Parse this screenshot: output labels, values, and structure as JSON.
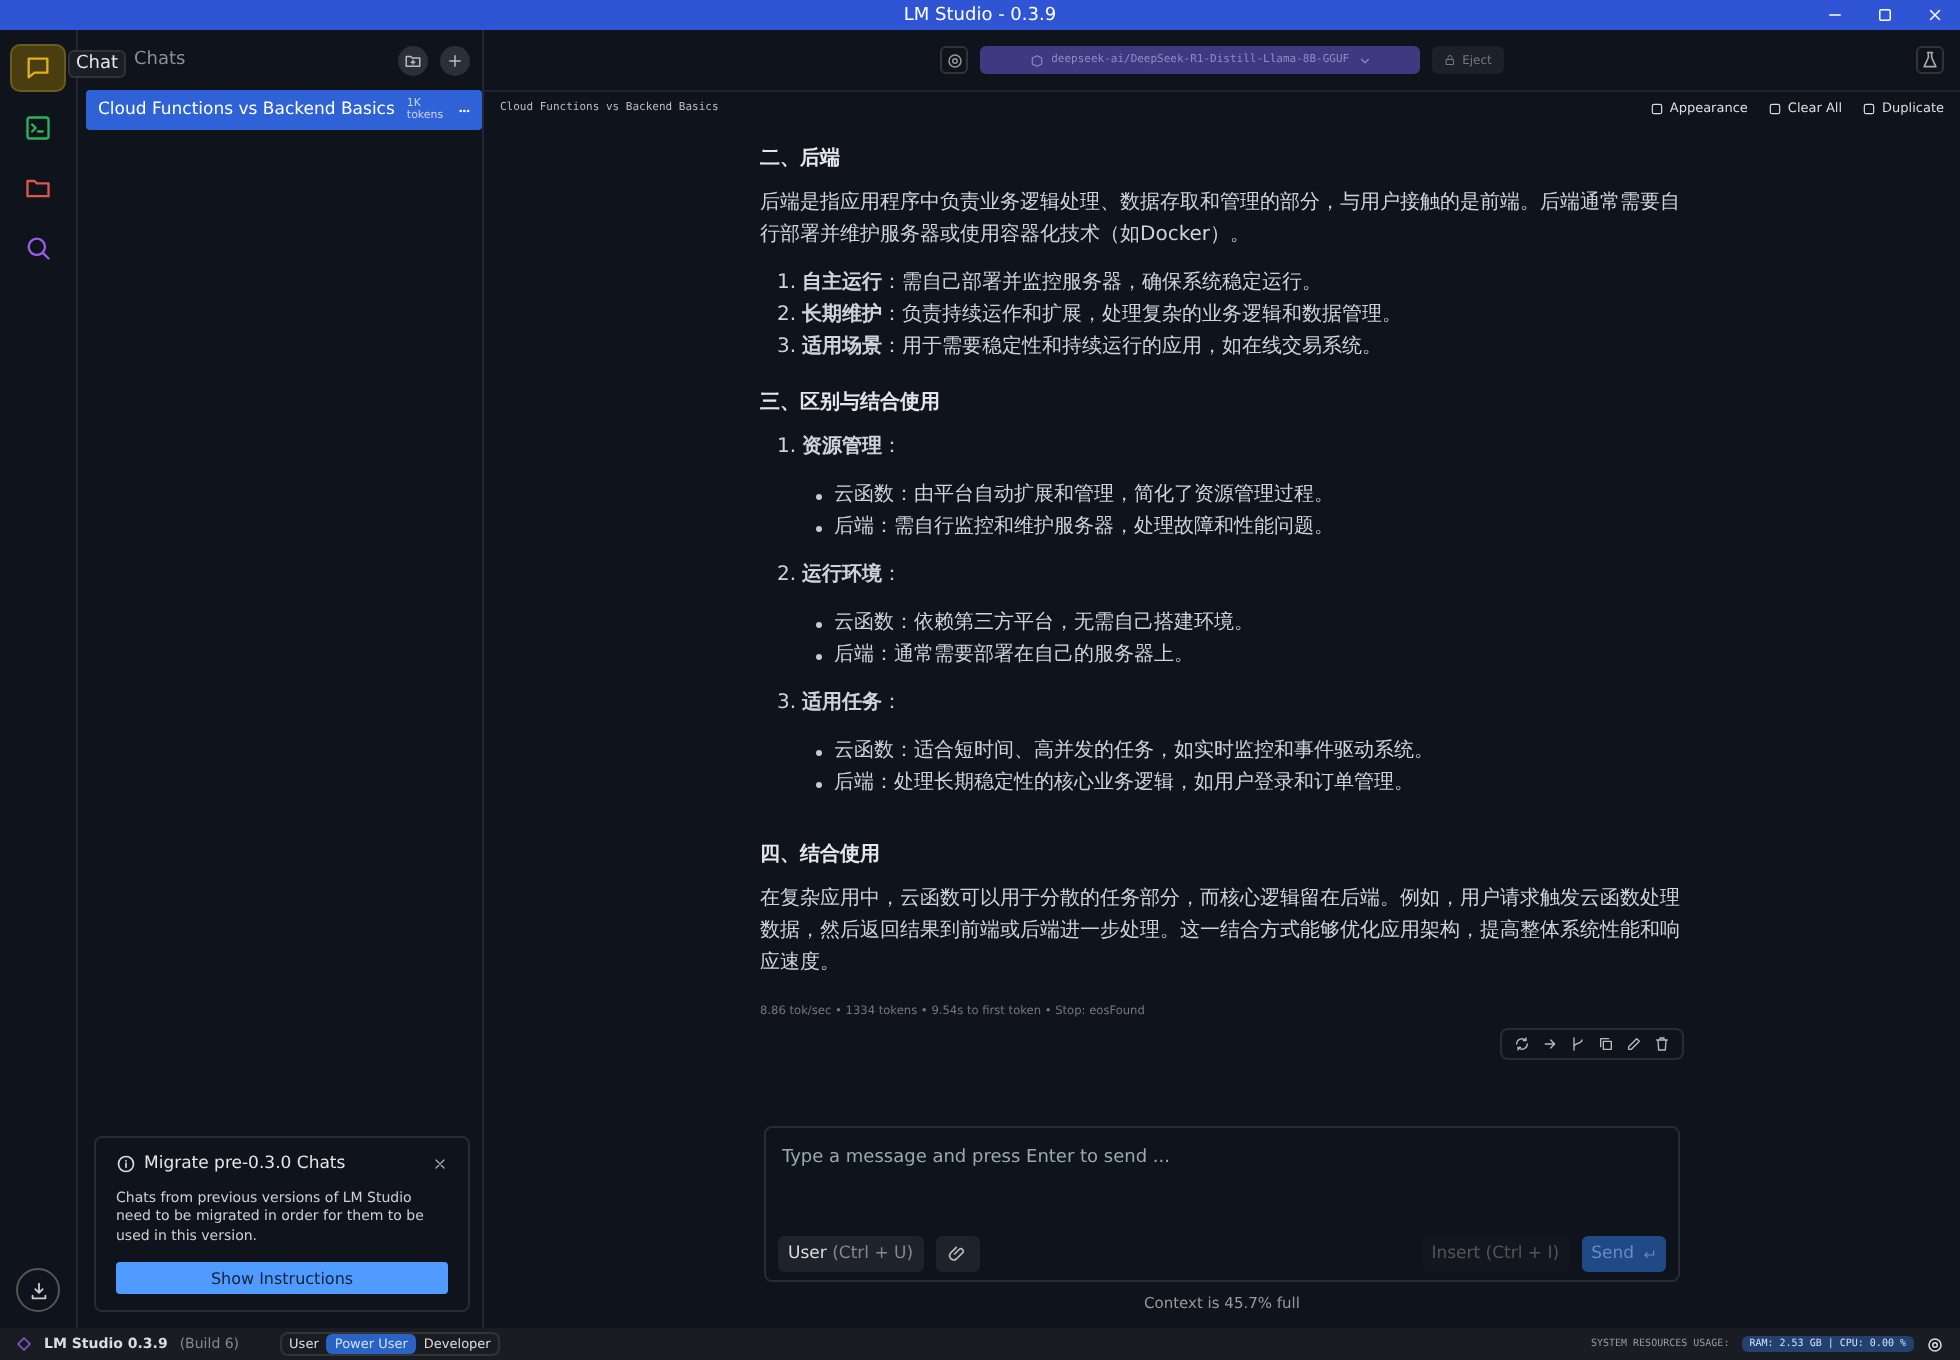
{
  "window": {
    "title": "LM Studio - 0.3.9"
  },
  "rail": {
    "items": [
      {
        "kind": "chat",
        "selected": true
      },
      {
        "kind": "terminal",
        "selected": false
      },
      {
        "kind": "folder",
        "selected": false
      },
      {
        "kind": "search",
        "selected": false
      }
    ],
    "tooltip": "Chat"
  },
  "sidebar": {
    "title": "Chats",
    "chats": [
      {
        "title": "Cloud Functions vs Backend Basics",
        "tokens": "1K tokens",
        "selected": true
      }
    ],
    "notice": {
      "title": "Migrate pre-0.3.0 Chats",
      "body": "Chats from previous versions of LM Studio need to be migrated in order for them to be used in this version.",
      "button": "Show Instructions"
    }
  },
  "toolbar": {
    "model": "deepseek-ai/DeepSeek-R1-Distill-Llama-8B-GGUF",
    "eject": "Eject"
  },
  "chat": {
    "title": "Cloud Functions vs Backend Basics",
    "actions": [
      "Appearance",
      "Clear All",
      "Duplicate"
    ],
    "content": [
      {
        "kind": "heading",
        "text": "二、后端"
      },
      {
        "kind": "paragraph",
        "text": "后端是指应用程序中负责业务逻辑处理、数据存取和管理的部分，与用户接触的是前端。后端通常需要自行部署并维护服务器或使用容器化技术（如Docker）。"
      },
      {
        "kind": "list",
        "items": [
          {
            "number": "1.",
            "text": "**自主运行**：需自己部署并监控服务器，确保系统稳定运行。"
          },
          {
            "number": "2.",
            "text": "**长期维护**：负责持续运作和扩展，处理复杂的业务逻辑和数据管理。"
          },
          {
            "number": "3.",
            "text": "**适用场景**：用于需要稳定性和持续运行的应用，如在线交易系统。"
          }
        ]
      },
      {
        "kind": "heading",
        "text": "三、区别与结合使用"
      },
      {
        "kind": "list",
        "items": [
          {
            "number": "1.",
            "text": "**资源管理**：",
            "bullets": [
              "云函数：由平台自动扩展和管理，简化了资源管理过程。",
              "后端：需自行监控和维护服务器，处理故障和性能问题。"
            ]
          },
          {
            "number": "2.",
            "text": "**运行环境**：",
            "bullets": [
              "云函数：依赖第三方平台，无需自己搭建环境。",
              "后端：通常需要部署在自己的服务器上。"
            ]
          },
          {
            "number": "3.",
            "text": "**适用任务**：",
            "bullets": [
              "云函数：适合短时间、高并发的任务，如实时监控和事件驱动系统。",
              "后端：处理长期稳定性的核心业务逻辑，如用户登录和订单管理。"
            ]
          }
        ]
      },
      {
        "kind": "heading",
        "text": "四、结合使用"
      },
      {
        "kind": "paragraph",
        "text": "在复杂应用中，云函数可以用于分散的任务部分，而核心逻辑留在后端。例如，用户请求触发云函数处理数据，然后返回结果到前端或后端进一步处理。这一结合方式能够优化应用架构，提高整体系统性能和响应速度。"
      }
    ],
    "stats": "8.86 tok/sec • 1334 tokens • 9.54s to first token • Stop: eosFound"
  },
  "composer": {
    "placeholder": "Type a message and press Enter to send ...",
    "role": "User",
    "role_shortcut": "(Ctrl + U)",
    "insert": "Insert",
    "insert_shortcut": "(Ctrl + I)",
    "send": "Send",
    "context": "Context is 45.7% full"
  },
  "status_bar": {
    "app": "LM Studio 0.3.9",
    "build": "(Build 6)",
    "modes": [
      {
        "label": "User",
        "selected": false
      },
      {
        "label": "Power User",
        "selected": true
      },
      {
        "label": "Developer",
        "selected": false
      }
    ],
    "resources_label": "SYSTEM RESOURCES USAGE:",
    "resources": "RAM: 2.53 GB | CPU: 0.00 %"
  }
}
